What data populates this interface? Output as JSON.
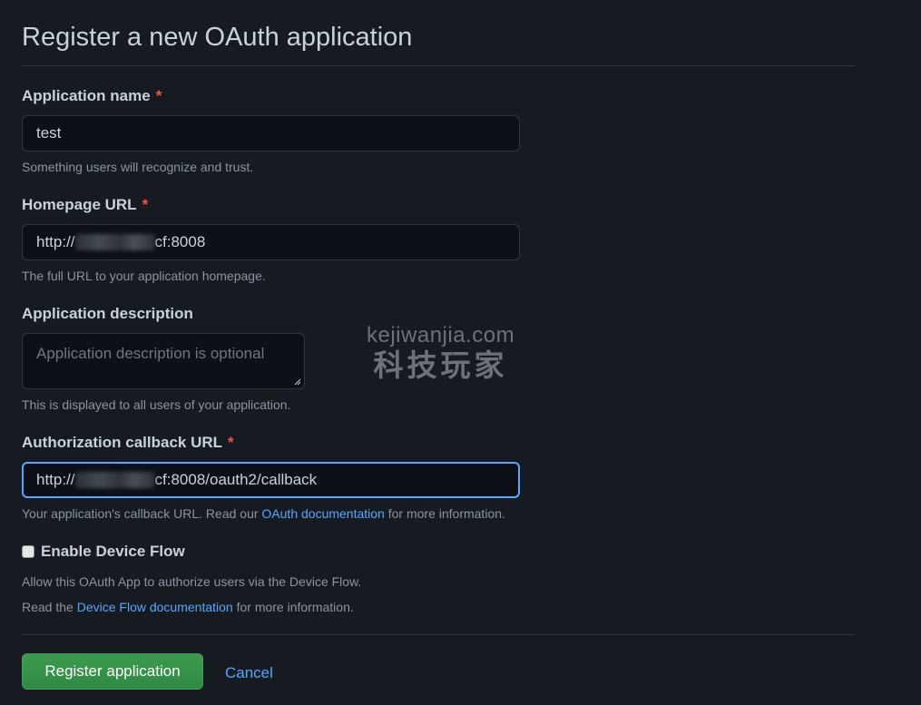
{
  "page": {
    "title": "Register a new OAuth application"
  },
  "form": {
    "app_name": {
      "label": "Application name",
      "required_mark": "*",
      "value": "test",
      "hint": "Something users will recognize and trust."
    },
    "homepage_url": {
      "label": "Homepage URL",
      "required_mark": "*",
      "value_prefix": "http://",
      "value_suffix": "cf:8008",
      "hint": "The full URL to your application homepage."
    },
    "description": {
      "label": "Application description",
      "placeholder": "Application description is optional",
      "hint": "This is displayed to all users of your application."
    },
    "callback_url": {
      "label": "Authorization callback URL",
      "required_mark": "*",
      "value_prefix": "http://",
      "value_suffix": "cf:8008/oauth2/callback",
      "hint_before": "Your application's callback URL. Read our ",
      "hint_link": "OAuth documentation",
      "hint_after": " for more information."
    },
    "device_flow": {
      "label": "Enable Device Flow",
      "checked": false,
      "hint_line1": "Allow this OAuth App to authorize users via the Device Flow.",
      "hint_line2_before": "Read the ",
      "hint_line2_link": "Device Flow documentation",
      "hint_line2_after": " for more information."
    }
  },
  "actions": {
    "register_label": "Register application",
    "cancel_label": "Cancel"
  },
  "watermark": {
    "url": "kejiwanjia.com",
    "text": "科技玩家"
  },
  "colors": {
    "background": "#161b22",
    "input_bg": "#0d1117",
    "border": "#30363d",
    "accent": "#58a6ff",
    "required": "#f85149",
    "primary_button": "#2f8a41"
  },
  "icons": {
    "resize": "textarea-resize-icon"
  }
}
